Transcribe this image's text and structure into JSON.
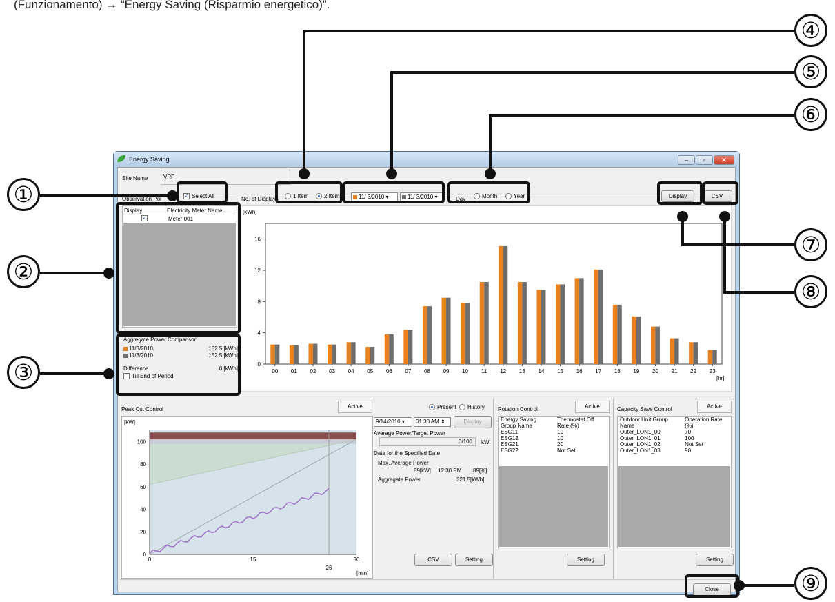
{
  "caption": "(Funzionamento) → “Energy Saving (Risparmio energetico)”.",
  "window": {
    "title": "Energy Saving",
    "min": "–",
    "max": "▫",
    "close": "✕"
  },
  "site": {
    "label": "Site Name",
    "value": "VRF"
  },
  "observation": {
    "label": "Observation Poi",
    "select_all": "Select All",
    "no_displays_label": "No. of Displays",
    "opt1": "1 Item",
    "opt2": "2 Items",
    "date1": "11/ 3/2010",
    "date2": "11/ 3/2010",
    "period_day": "Day",
    "period_month": "Month",
    "period_year": "Year",
    "display_btn": "Display",
    "csv_btn": "CSV"
  },
  "meters": {
    "col_display": "Display",
    "col_name": "Electricity Meter Name",
    "rows": [
      {
        "name": "Meter 001",
        "checked": true
      }
    ]
  },
  "aggregate": {
    "title": "Aggregate Power Comparison",
    "row1_date": "11/3/2010",
    "row1_value": "152.5 [kWh]",
    "row2_date": "11/3/2010",
    "row2_value": "152.5 [kWh]",
    "diff_label": "Difference",
    "diff_value": "0 [kWh]",
    "till_end": "Till End of Period"
  },
  "chart_data": {
    "type": "bar",
    "ylabel": "[kWh]",
    "xlabel": "[hr]",
    "ylim": [
      0,
      18
    ],
    "yticks": [
      "0",
      "4",
      "8",
      "12",
      "16"
    ],
    "categories": [
      "00",
      "01",
      "02",
      "03",
      "04",
      "05",
      "06",
      "07",
      "08",
      "09",
      "10",
      "11",
      "12",
      "13",
      "14",
      "15",
      "16",
      "17",
      "18",
      "19",
      "20",
      "21",
      "22",
      "23"
    ],
    "series": [
      {
        "color": "#e8811e",
        "values": [
          2.5,
          2.4,
          2.6,
          2.5,
          2.8,
          2.2,
          3.8,
          4.4,
          7.4,
          8.5,
          7.8,
          10.5,
          15.1,
          10.5,
          9.5,
          10.2,
          11.0,
          12.1,
          7.6,
          6.1,
          4.8,
          3.3,
          2.8,
          1.8
        ]
      },
      {
        "color": "#6e6e6e",
        "values": [
          2.5,
          2.4,
          2.6,
          2.5,
          2.8,
          2.2,
          3.8,
          4.4,
          7.4,
          8.5,
          7.8,
          10.5,
          15.1,
          10.5,
          9.5,
          10.2,
          11.0,
          12.1,
          7.6,
          6.1,
          4.8,
          3.3,
          2.8,
          1.8
        ]
      }
    ]
  },
  "peak": {
    "title": "Peak Cut Control",
    "active": "Active",
    "unit": "[kW]",
    "yticks": [
      "100",
      "80",
      "60",
      "40",
      "20",
      "0"
    ],
    "xticks": [
      "0",
      "15",
      "30"
    ],
    "marker": "26",
    "xunit": "[min]"
  },
  "peak_panel": {
    "present": "Present",
    "history": "History",
    "date": "9/14/2010",
    "time": "01:30 AM",
    "display_btn": "Display",
    "avg_label": "Average Power/Target Power",
    "avg_value": "0/100",
    "avg_unit": "kW",
    "data_label": "Data for the Specified Date",
    "max_label": "Max. Average Power",
    "max_kw": "89[kW]",
    "max_time": "12:30 PM",
    "max_pct": "89[%]",
    "agg_label": "Aggregate Power",
    "agg_value": "321.5[kWh]",
    "csv_btn": "CSV",
    "setting_btn": "Setting"
  },
  "rotation": {
    "title": "Rotation Control",
    "active": "Active",
    "col1": "Energy Saving Group Name",
    "col2": "Thermostat Off Rate (%)",
    "rows": [
      [
        "ESG11",
        "10"
      ],
      [
        "ESG12",
        "10"
      ],
      [
        "ESG21",
        "20"
      ],
      [
        "ESG22",
        "Not Set"
      ]
    ],
    "setting_btn": "Setting"
  },
  "capacity": {
    "title": "Capacity Save Control",
    "active": "Active",
    "col1": "Outdoor Unit Group Name",
    "col2": "Operation Rate (%)",
    "rows": [
      [
        "Outer_LON1_00",
        "70"
      ],
      [
        "Outer_LON1_01",
        "100"
      ],
      [
        "Outer_LON1_02",
        "Not Set"
      ],
      [
        "Outer_LON1_03",
        "90"
      ]
    ],
    "setting_btn": "Setting"
  },
  "close_btn": "Close",
  "callouts": [
    "①",
    "②",
    "③",
    "④",
    "⑤",
    "⑥",
    "⑦",
    "⑧",
    "⑨"
  ]
}
